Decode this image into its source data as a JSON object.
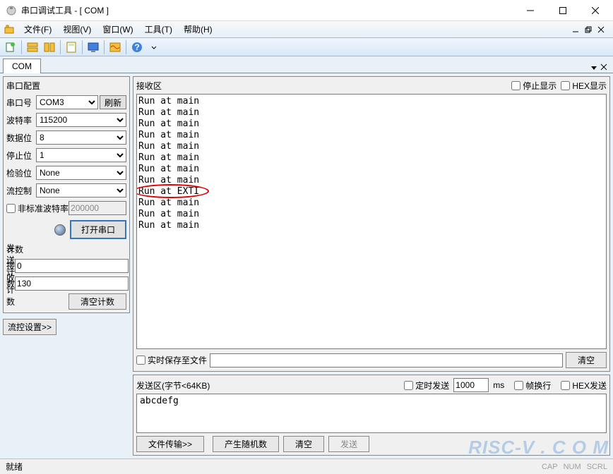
{
  "window": {
    "title": "串口调试工具 - [ COM ]"
  },
  "menu": {
    "file": "文件(F)",
    "view": "视图(V)",
    "window": "窗口(W)",
    "tools": "工具(T)",
    "help": "帮助(H)"
  },
  "tab": {
    "label": "COM"
  },
  "serial": {
    "group_title": "串口配置",
    "port_label": "串口号",
    "port_value": "COM3",
    "refresh": "刷新",
    "baud_label": "波特率",
    "baud_value": "115200",
    "databits_label": "数据位",
    "databits_value": "8",
    "stopbits_label": "停止位",
    "stopbits_value": "1",
    "parity_label": "检验位",
    "parity_value": "None",
    "flow_label": "流控制",
    "flow_value": "None",
    "nonstd_label": "非标准波特率",
    "nonstd_value": "200000",
    "open_btn": "打开串口"
  },
  "count": {
    "title": "计数",
    "send_label": "发送计数",
    "send_value": "0",
    "recv_label": "接收计数",
    "recv_value": "130",
    "clear": "清空计数"
  },
  "flowctl_btn": "流控设置>>",
  "recv": {
    "title": "接收区",
    "stop_display": "停止显示",
    "hex_display": "HEX显示",
    "lines": [
      "Run at main",
      "Run at main",
      "Run at main",
      "Run at main",
      "Run at main",
      "Run at main",
      "Run at main",
      "Run at main",
      "Run at EXTI",
      "Run at main",
      "Run at main",
      "Run at main"
    ],
    "save_label": "实时保存至文件",
    "clear": "清空"
  },
  "send": {
    "title": "发送区(字节<64KB)",
    "timed_label": "定时发送",
    "timed_value": "1000",
    "timed_unit": "ms",
    "wrap_label": "帧换行",
    "hex_label": "HEX发送",
    "content": "abcdefg",
    "file_btn": "文件传输>>",
    "rand_btn": "产生随机数",
    "clear_btn": "清空",
    "send_btn": "发送"
  },
  "status": {
    "ready": "就绪",
    "cap": "CAP",
    "num": "NUM",
    "scrl": "SCRL"
  },
  "watermark": "RISC-V . C O M"
}
